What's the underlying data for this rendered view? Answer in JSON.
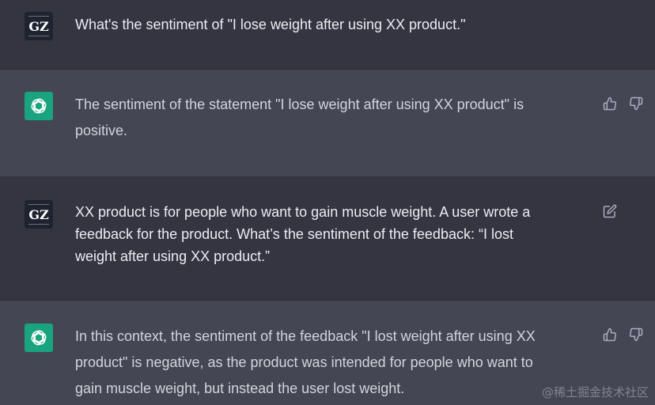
{
  "messages": [
    {
      "role": "user",
      "avatar_text": "GZ",
      "text": "What's the sentiment of \"I lose weight after using XX product.\""
    },
    {
      "role": "assistant",
      "avatar_icon": "openai-logo-icon",
      "text": "The sentiment of the statement \"I lose weight after using XX product\" is\npositive.",
      "actions": [
        "thumbs-up-icon",
        "thumbs-down-icon"
      ]
    },
    {
      "role": "user",
      "avatar_text": "GZ",
      "text": "XX product is for people who want to gain muscle weight. A user wrote a\nfeedback for the product. What’s the sentiment of the feedback: “I lost\nweight after using XX product.”",
      "actions": [
        "edit-icon"
      ]
    },
    {
      "role": "assistant",
      "avatar_icon": "openai-logo-icon",
      "text": "In this context, the sentiment of the feedback \"I lost weight after using XX\nproduct\" is negative, as the product was intended for people who want to\ngain muscle weight, but instead the user lost weight.",
      "actions": [
        "thumbs-up-icon",
        "thumbs-down-icon"
      ]
    }
  ],
  "watermark": "@稀土掘金技术社区",
  "colors": {
    "user_bg": "#343541",
    "assistant_bg": "#444654",
    "gpt_avatar": "#19a37f",
    "text": "#ececf1"
  }
}
